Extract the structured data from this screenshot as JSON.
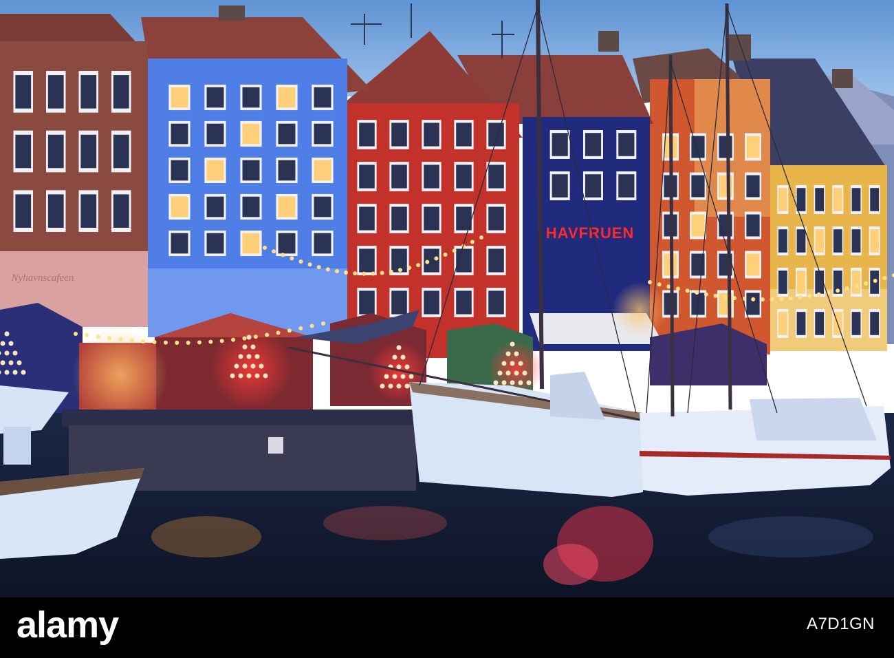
{
  "photo": {
    "shop_sign": "HAVFRUEN",
    "cafe_sign": "Nyhavnscafeen"
  },
  "watermark": {
    "logo_text": "alamy",
    "image_id": "A7D1GN"
  },
  "colors": {
    "sky": "#6e9fd6",
    "water": "#16203a",
    "blue_house": "#4f7fe6",
    "red_house": "#c3322b",
    "navy_house": "#1e2a78",
    "yellow_house": "#e9b74b",
    "lights": "#ffd27a"
  }
}
